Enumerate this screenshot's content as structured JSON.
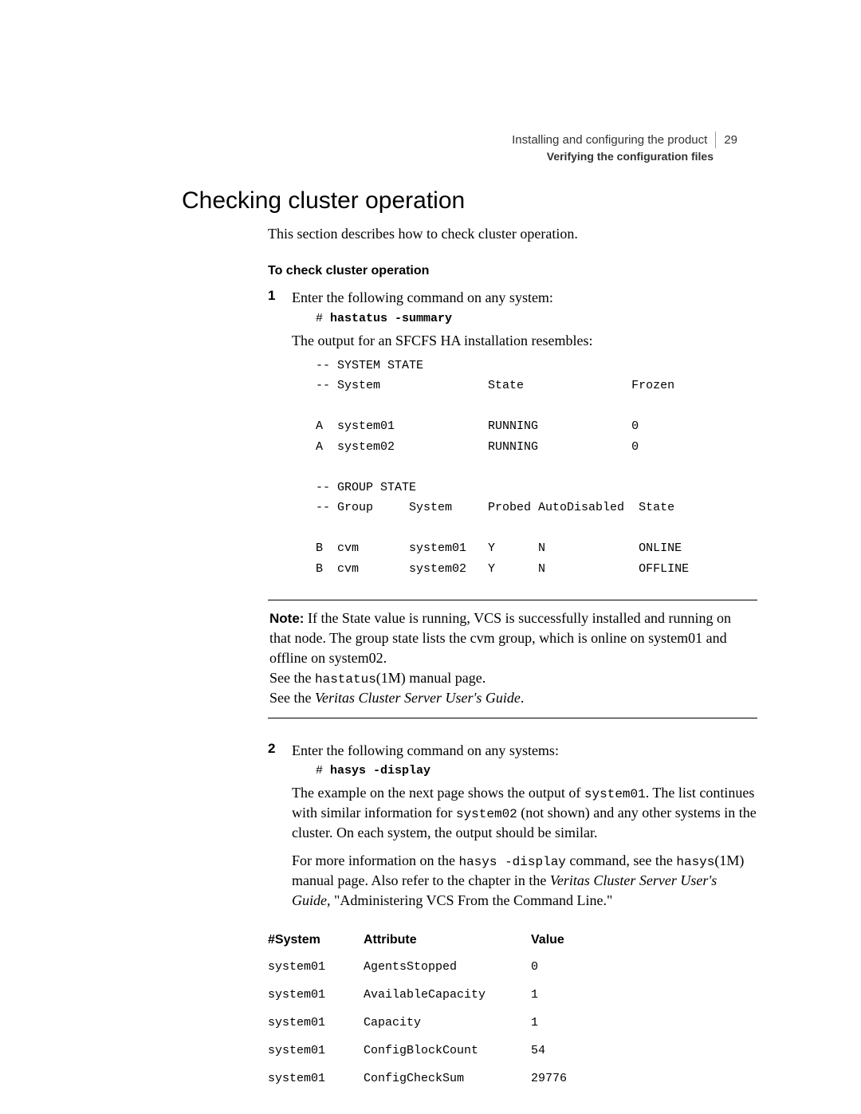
{
  "header": {
    "chapter": "Installing and configuring the product",
    "page_number": "29",
    "section": "Verifying the configuration files"
  },
  "h1": "Checking cluster operation",
  "intro": "This section describes how to check cluster operation.",
  "proc_title": "To check cluster operation",
  "step1": {
    "num": "1",
    "text": "Enter the following command on any system:",
    "prompt": "# ",
    "cmd": "hastatus -summary",
    "output_label": "The output for an SFCFS HA installation resembles:",
    "pre": "-- SYSTEM STATE\n-- System               State               Frozen\n\nA  system01             RUNNING             0\nA  system02             RUNNING             0\n\n-- GROUP STATE\n-- Group     System     Probed AutoDisabled  State\n\nB  cvm       system01   Y      N             ONLINE\nB  cvm       system02   Y      N             OFFLINE"
  },
  "note": {
    "label": "Note:",
    "body_a": " If the State value is running, VCS is successfully installed and running on that node. The group state lists the cvm group, which is online on system01 and offline on system02.",
    "see1_a": "See the ",
    "see1_b": "hastatus",
    "see1_c": "(1M) manual page.",
    "see2_a": "See the ",
    "see2_b": "Veritas Cluster Server User's Guide",
    "see2_c": "."
  },
  "step2": {
    "num": "2",
    "text": "Enter the following command on any systems:",
    "prompt": "# ",
    "cmd": "hasys -display",
    "p1_a": "The example on the next page shows the output of ",
    "p1_b": "system01",
    "p1_c": ". The list continues with similar information for ",
    "p1_d": "system02",
    "p1_e": " (not shown) and any other systems in the cluster. On each system, the output should be similar.",
    "p2_a": "For more information on the ",
    "p2_b": "hasys -display",
    "p2_c": " command, see the ",
    "p2_d": "hasys",
    "p2_e": "(1M) manual page. Also refer to the chapter in the ",
    "p2_f": "Veritas Cluster Server User's Guide",
    "p2_g": ", \"Administering VCS From the Command Line.\""
  },
  "table": {
    "headers": {
      "c1": "#System",
      "c2": "Attribute",
      "c3": "Value"
    },
    "rows": [
      {
        "sys": "system01",
        "attr": "AgentsStopped",
        "val": "0"
      },
      {
        "sys": "system01",
        "attr": "AvailableCapacity",
        "val": "1"
      },
      {
        "sys": "system01",
        "attr": "Capacity",
        "val": "1"
      },
      {
        "sys": "system01",
        "attr": "ConfigBlockCount",
        "val": "54"
      },
      {
        "sys": "system01",
        "attr": "ConfigCheckSum",
        "val": "29776"
      }
    ]
  }
}
